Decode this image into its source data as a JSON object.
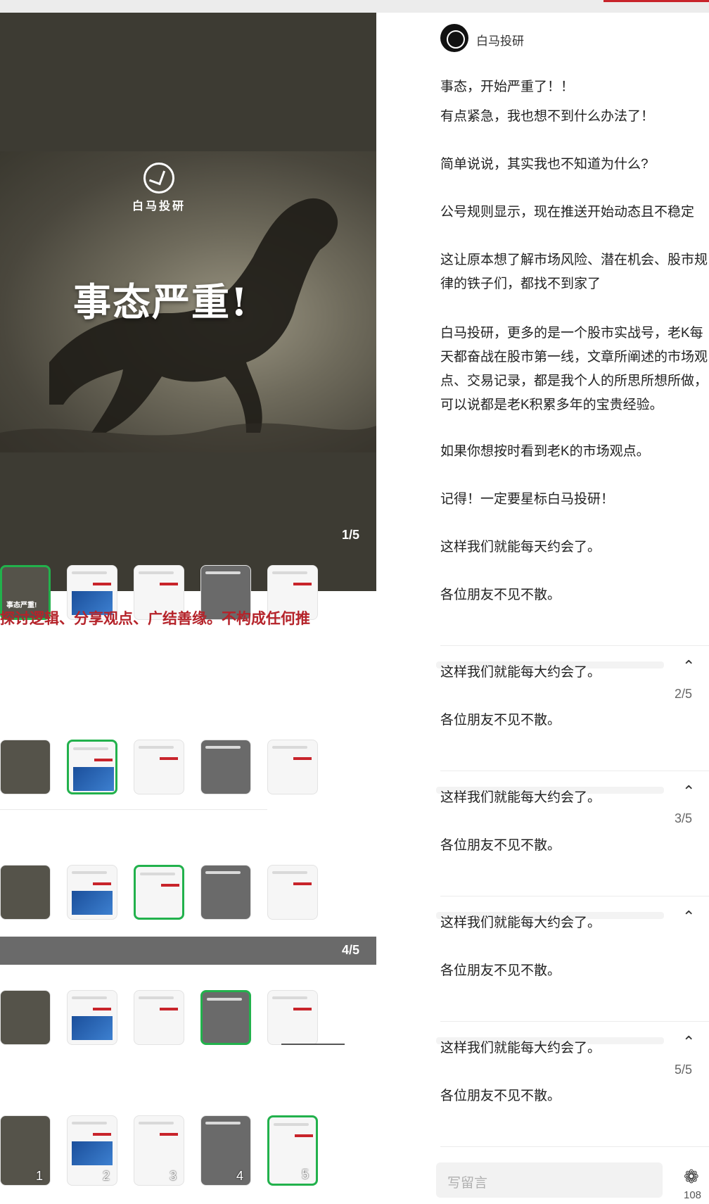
{
  "viewer": {
    "hero_brand": "白马投研",
    "hero_title": "事态严重!",
    "counter": "1/5",
    "banner_text": "探讨逻辑、分享观点、广结善缘。不构成任何推",
    "pages": [
      "2/5",
      "3/5",
      "4/5",
      "5/5"
    ],
    "thumb_title": "事态严重!",
    "thumb_numbers": [
      "1",
      "2",
      "3",
      "4",
      "5"
    ]
  },
  "author": {
    "name": "白马投研"
  },
  "article": {
    "paragraphs": [
      "事态，开始严重了！！",
      "有点紧急，我也想不到什么办法了！",
      "简单说说，其实我也不知道为什么?",
      "公号规则显示，现在推送开始动态且不稳定",
      "这让原本想了解市场风险、潜在机会、股市规",
      "律的铁子们，都找不到家了",
      "白马投研，更多的是一个股市实战号，老K每",
      "天都奋战在股市第一线，文章所阐述的市场观",
      "点、交易记录，都是我个人的所思所想所做，",
      "可以说都是老K积累多年的宝贵经验。",
      "如果你想按时看到老K的市场观点。",
      "记得！一定要星标白马投研！",
      "这样我们就能每天约会了。",
      "各位朋友不见不散。"
    ],
    "repeat_top": "这样我们就能每大约会了。",
    "repeat_bottom": "各位朋友不见不散。"
  },
  "footer": {
    "comment_placeholder": "写留言",
    "like_count": "108"
  },
  "colors": {
    "accent": "#c8242b",
    "active_thumb": "#22b14c",
    "viewer_bg": "#3d3b33"
  }
}
